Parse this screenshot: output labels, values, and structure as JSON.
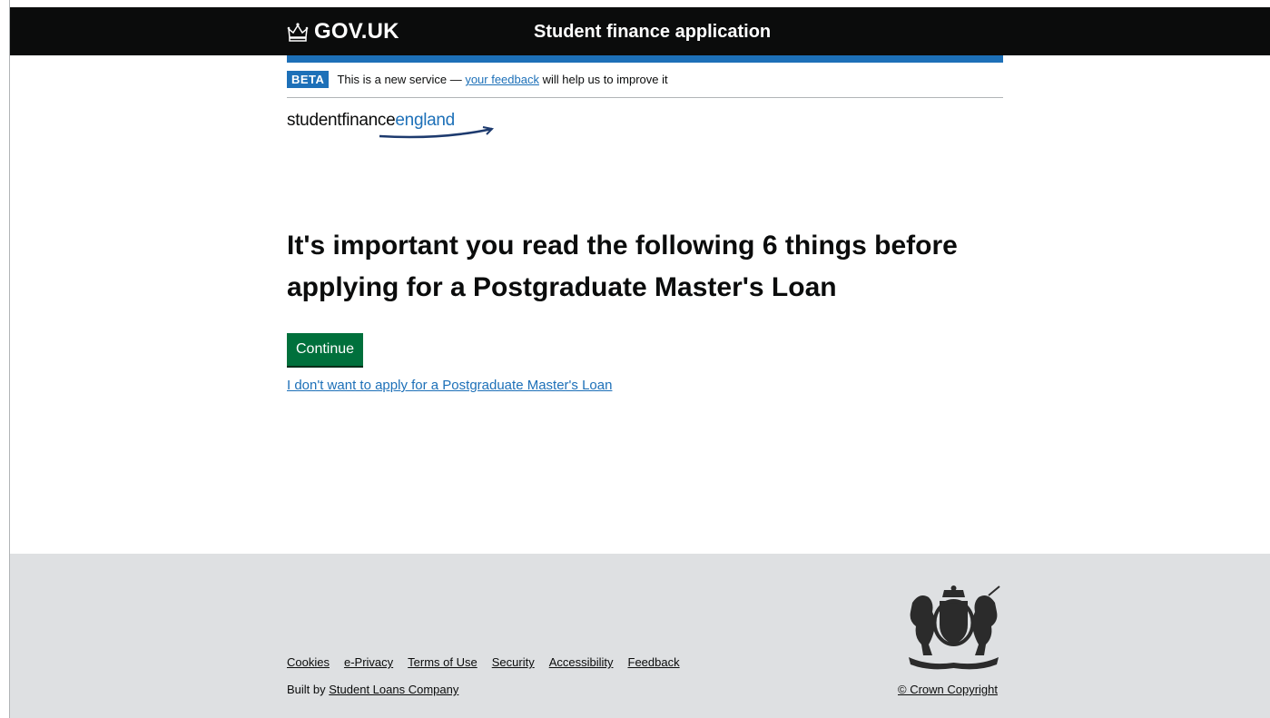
{
  "header": {
    "logo_text": "GOV.UK",
    "service_name": "Student finance application"
  },
  "phase_banner": {
    "tag": "BETA",
    "text_before": "This is a new service — ",
    "link_text": "your feedback",
    "text_after": " will help us to improve it"
  },
  "brand": {
    "word1": "studentfinance",
    "word2": "england"
  },
  "main": {
    "heading": "It's important you read the following 6 things before applying for a Postgraduate Master's Loan",
    "continue_button": "Continue",
    "opt_out_link": "I don't want to apply for a Postgraduate Master's Loan"
  },
  "footer": {
    "links": [
      "Cookies",
      "e-Privacy",
      "Terms of Use",
      "Security",
      "Accessibility",
      "Feedback"
    ],
    "built_by_prefix": "Built by ",
    "built_by_link": "Student Loans Company",
    "copyright": "© Crown Copyright"
  },
  "colors": {
    "header_bg": "#0b0c0c",
    "accent_blue": "#1d70b8",
    "button_green": "#00703c",
    "footer_bg": "#dee0e2"
  },
  "icons": {
    "logo": "crown-icon",
    "crest": "royal-coat-of-arms-icon"
  }
}
